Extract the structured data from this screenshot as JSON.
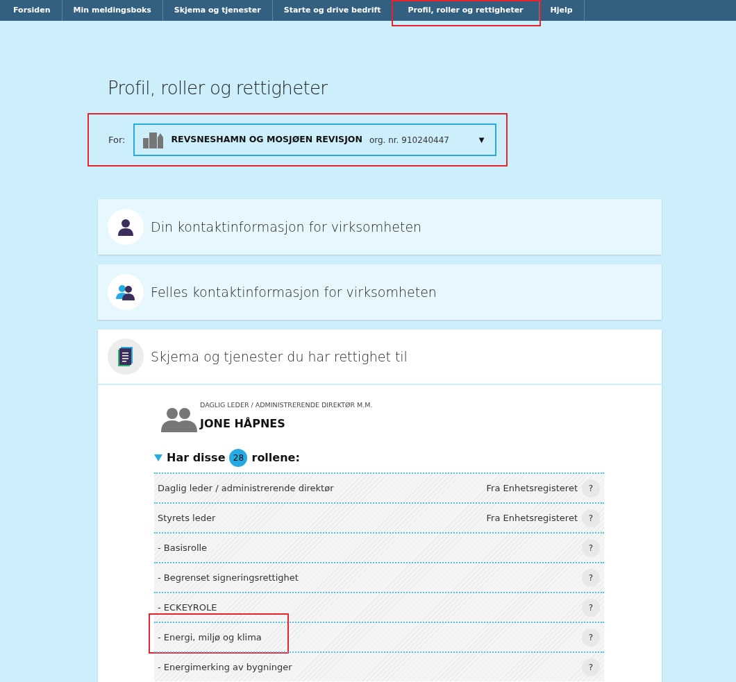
{
  "nav": [
    {
      "label": "Forsiden",
      "highlighted": false
    },
    {
      "label": "Min meldingsboks",
      "highlighted": false
    },
    {
      "label": "Skjema og tjenester",
      "highlighted": false
    },
    {
      "label": "Starte og drive bedrift",
      "highlighted": false
    },
    {
      "label": "Profil, roller og rettigheter",
      "highlighted": true
    },
    {
      "label": "Hjelp",
      "highlighted": false
    }
  ],
  "page_title": "Profil, roller og rettigheter",
  "for_selector": {
    "label": "For:",
    "org_name": "REVSNESHAMN OG MOSJØEN REVISJON",
    "org_number": "org. nr. 910240447",
    "caret": "▼",
    "highlighted": true
  },
  "sections": [
    {
      "title": "Din kontaktinformasjon for virksomheten",
      "kind": "person",
      "expanded": false
    },
    {
      "title": "Felles kontaktinformasjon for virksomheten",
      "kind": "people",
      "expanded": false
    },
    {
      "title": "Skjema og tjenester du har rettighet til",
      "kind": "forms",
      "expanded": true
    }
  ],
  "person": {
    "role_caption": "DAGLIG LEDER / ADMINISTRERENDE DIREKTØR M.M.",
    "name": "JONE HÅPNES"
  },
  "roles_heading": {
    "before": "Har disse",
    "count": "28",
    "after": "rollene:",
    "expanded": true
  },
  "roles": [
    {
      "name": "Daglig leder / administrerende direktør",
      "source": "Fra Enhetsregisteret",
      "help": "?",
      "highlighted": false
    },
    {
      "name": "Styrets leder",
      "source": "Fra Enhetsregisteret",
      "help": "?",
      "highlighted": false
    },
    {
      "name": "- Basisrolle",
      "help": "?",
      "highlighted": false
    },
    {
      "name": "- Begrenset signeringsrettighet",
      "help": "?",
      "highlighted": false
    },
    {
      "name": "- ECKEYROLE",
      "help": "?",
      "highlighted": false
    },
    {
      "name": "- Energi, miljø og klima",
      "help": "?",
      "highlighted": true
    },
    {
      "name": "- Energimerking av bygninger",
      "help": "?",
      "highlighted": false
    }
  ]
}
